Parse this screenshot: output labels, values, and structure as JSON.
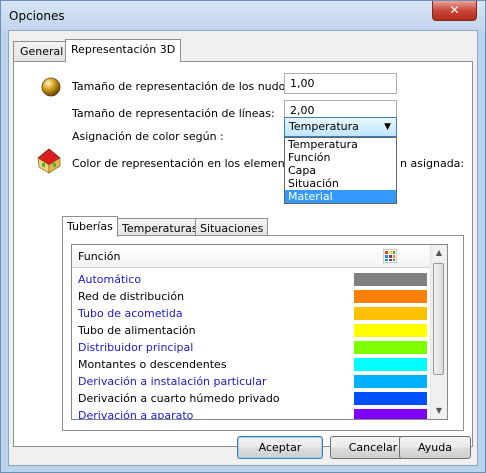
{
  "window": {
    "title": "Opciones",
    "close_glyph": "✕"
  },
  "tabs": [
    "General",
    "Representación 3D"
  ],
  "fields": {
    "node_size_label": "Tamaño de representación de los nudos:",
    "node_size_value": "1,00",
    "line_size_label": "Tamaño de representación de líneas:",
    "line_size_value": "2,00",
    "color_label": "Asignación de color según :",
    "color_selected": "Temperatura",
    "color_elements_label_left": "Color de representación en los elementos d",
    "color_elements_label_right": "n asignada:"
  },
  "dropdown_options": [
    "Temperatura",
    "Función",
    "Capa",
    "Situación",
    "Material"
  ],
  "dropdown_highlighted": "Material",
  "subtabs": [
    "Tuberías",
    "Temperaturas",
    "Situaciones"
  ],
  "list": {
    "header": "Función",
    "header_icon": "palette-icon",
    "rows": [
      {
        "name": "Automático",
        "color": "#808080",
        "link": true
      },
      {
        "name": "Red de distribución",
        "color": "#ff8000",
        "link": false
      },
      {
        "name": "Tubo de acometida",
        "color": "#ffc000",
        "link": true
      },
      {
        "name": "Tubo de alimentación",
        "color": "#ffff00",
        "link": false
      },
      {
        "name": "Distribuidor principal",
        "color": "#80ff00",
        "link": true
      },
      {
        "name": "Montantes o descendentes",
        "color": "#00ffff",
        "link": false
      },
      {
        "name": "Derivación a instalación particular",
        "color": "#00b0ff",
        "link": true
      },
      {
        "name": "Derivación a cuarto húmedo privado",
        "color": "#0050ff",
        "link": false
      },
      {
        "name": "Derivación a aparato",
        "color": "#8000ff",
        "link": true
      }
    ]
  },
  "buttons": {
    "accept": "Aceptar",
    "cancel": "Cancelar",
    "help": "Ayuda"
  },
  "icons": {
    "node": "sphere-icon",
    "house": "house-icon"
  },
  "colors": {
    "link_text": "#1a1acc",
    "selection": "#3399ff"
  }
}
